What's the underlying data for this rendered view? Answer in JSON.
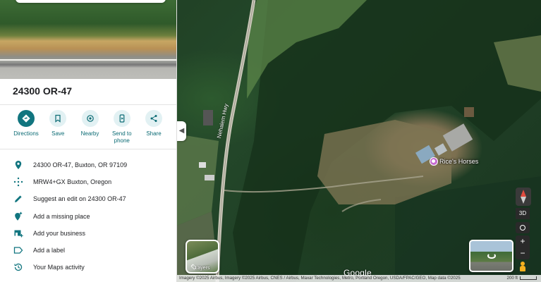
{
  "place": {
    "title": "24300 OR-47"
  },
  "actions": [
    {
      "label": "Directions",
      "icon": "directions-icon"
    },
    {
      "label": "Save",
      "icon": "bookmark-icon"
    },
    {
      "label": "Nearby",
      "icon": "nearby-icon"
    },
    {
      "label": "Send to\nphone",
      "icon": "phone-icon"
    },
    {
      "label": "Share",
      "icon": "share-icon"
    }
  ],
  "info": [
    {
      "text": "24300 OR-47, Buxton, OR 97109",
      "icon": "location-pin-icon"
    },
    {
      "text": "MRW4+GX Buxton, Oregon",
      "icon": "plus-code-icon"
    },
    {
      "text": "Suggest an edit on 24300 OR-47",
      "icon": "edit-pencil-icon"
    },
    {
      "text": "Add a missing place",
      "icon": "add-place-icon"
    },
    {
      "text": "Add your business",
      "icon": "business-icon"
    },
    {
      "text": "Add a label",
      "icon": "label-icon"
    },
    {
      "text": "Your Maps activity",
      "icon": "history-icon"
    }
  ],
  "map": {
    "road_label": "Nehalem Hwy",
    "poi_label": "Rice's Horses",
    "layers_label": "Layers",
    "logo_text": "Google",
    "compass_3d": "3D",
    "zoom_in": "+",
    "zoom_out": "−",
    "attribution": "Imagery ©2025 Airbus, Imagery ©2025 Airbus, CNES / Airbus, Maxar Technologies, Metro, Portland Oregon, USDA/FPAC/GEO, Map data ©2025",
    "scale": "200 ft"
  },
  "colors": {
    "accent": "#11757f",
    "pin": "#ea4335",
    "poi": "#c56bd0"
  }
}
